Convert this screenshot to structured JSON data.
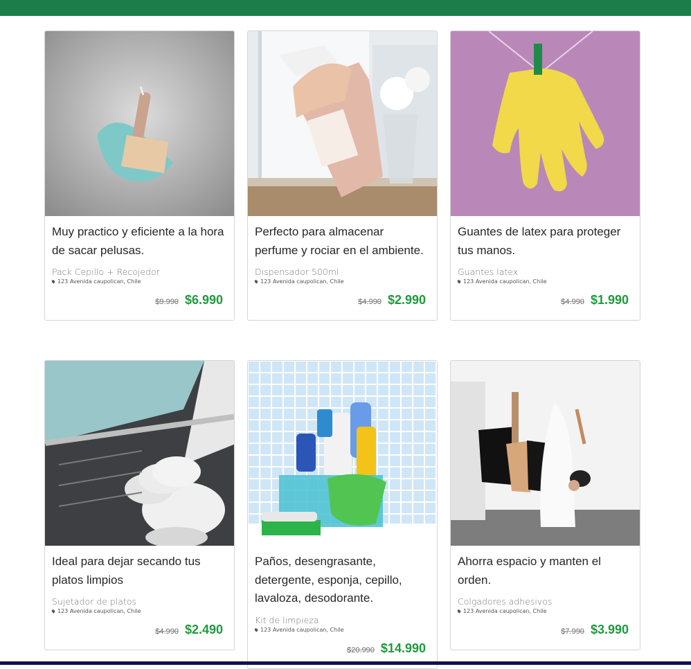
{
  "products": [
    {
      "description": "Muy practico y eficiente a la hora de sacar pelusas.",
      "name": "Pack Cepillo + Recojedor",
      "address": "123 Avenida caupolican, Chile",
      "old_price": "$9.990",
      "price": "$6.990",
      "image": "brush-dustpan-photo"
    },
    {
      "description": "Perfecto para almacenar perfume y rociar en el ambiente.",
      "name": "Dispensador 500ml",
      "address": "123 Avenida caupolican, Chile",
      "old_price": "$4.990",
      "price": "$2.990",
      "image": "spray-bottle-photo"
    },
    {
      "description": "Guantes de latex para proteger tus manos.",
      "name": "Guantes latex",
      "address": "123 Avenida caupolican, Chile",
      "old_price": "$4.990",
      "price": "$1.990",
      "image": "yellow-gloves-photo"
    },
    {
      "description": "Ideal para dejar secando tus platos limpios",
      "name": "Sujetador de platos",
      "address": "123 Avenida caupolican, Chile",
      "old_price": "$4.990",
      "price": "$2.490",
      "image": "dish-rack-photo"
    },
    {
      "description": "Paños, desengrasante, detergente, esponja, cepillo, lavaloza, desodorante.",
      "name": "Kit de limpieza",
      "address": "123 Avenida caupolican, Chile",
      "old_price": "$20.990",
      "price": "$14.990",
      "image": "cleaning-kit-photo"
    },
    {
      "description": "Ahorra espacio y manten el orden.",
      "name": "Colgadores adhesivos",
      "address": "123 Avenida caupolican, Chile",
      "old_price": "$7.990",
      "price": "$3.990",
      "image": "adhesive-hooks-photo"
    }
  ],
  "colors": {
    "header": "#1c7d4a",
    "price": "#1f9a3d",
    "footer": "#101052"
  }
}
